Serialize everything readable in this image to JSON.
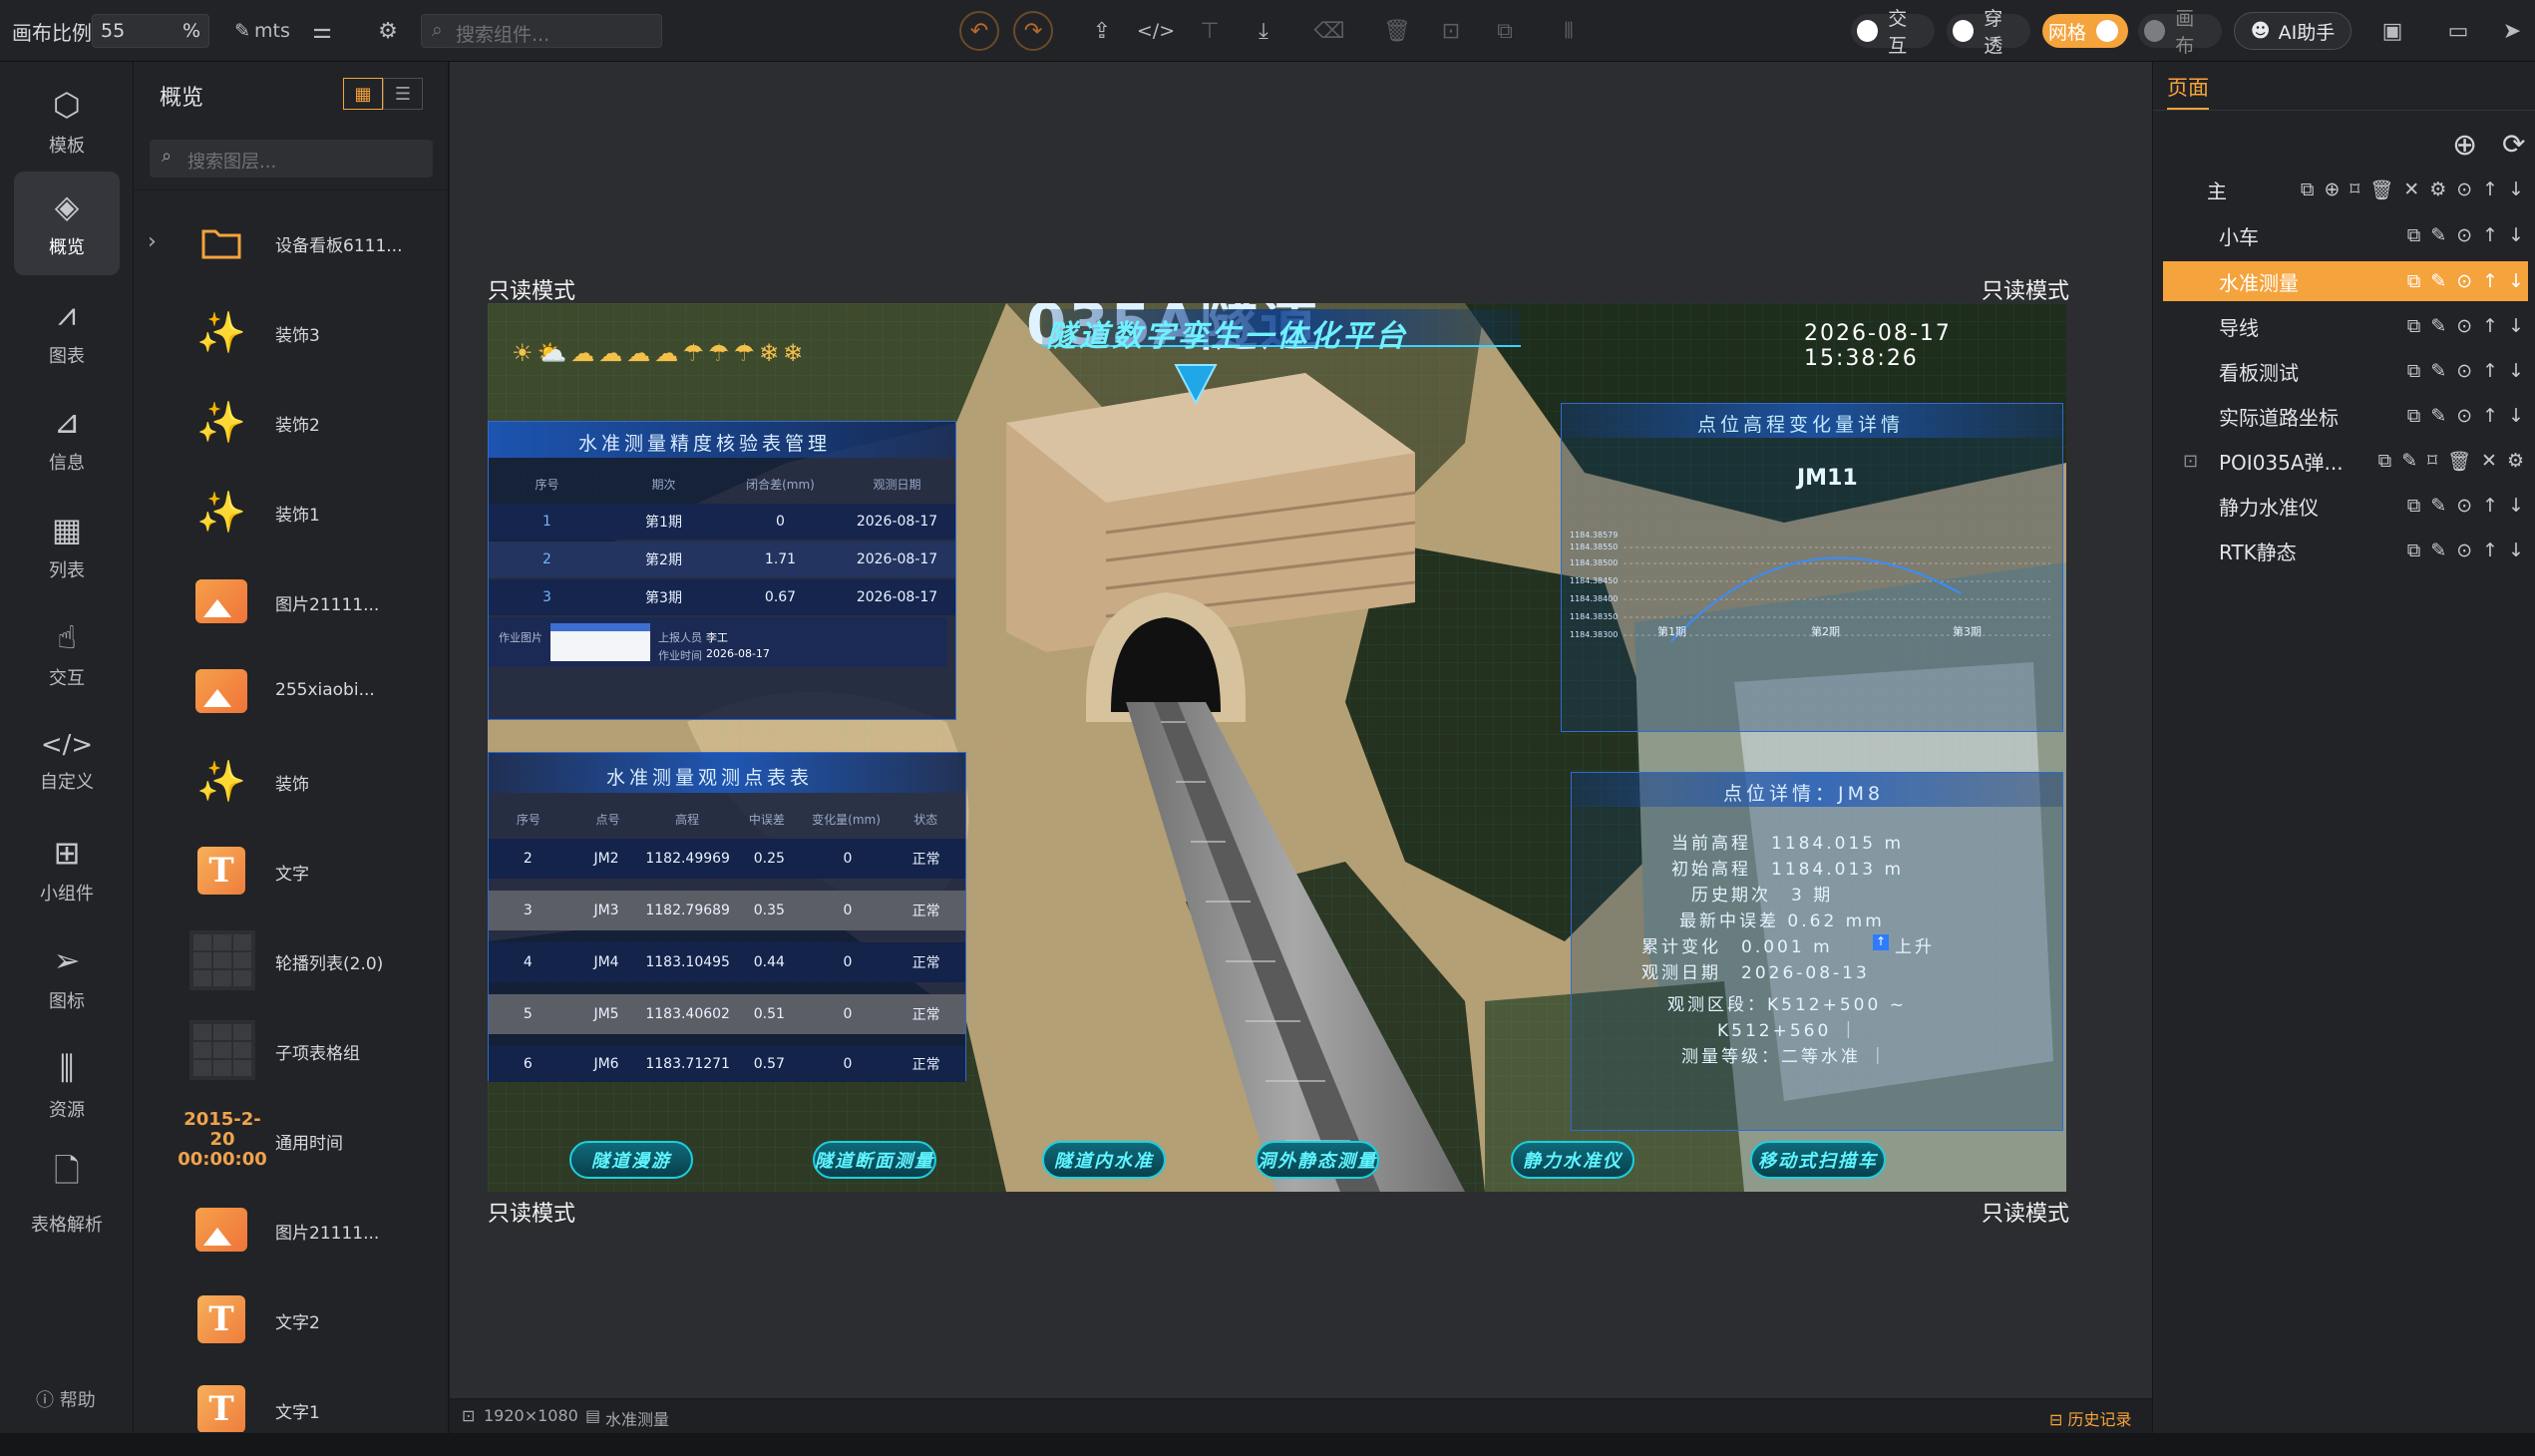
{
  "topbar": {
    "scale_label": "画布比例",
    "scale_value": "55",
    "scale_unit": "%",
    "font_label": "mts",
    "search_placeholder": "搜索组件...",
    "toggles": [
      {
        "label": "交互",
        "on": false
      },
      {
        "label": "穿透",
        "on": false
      },
      {
        "label": "网格",
        "on": true
      },
      {
        "label": "画布",
        "on": false
      }
    ],
    "ai_label": "AI助手"
  },
  "leftnav": {
    "items": [
      {
        "label": "模板",
        "icon": "template-icon"
      },
      {
        "label": "概览",
        "icon": "layers-icon",
        "active": true
      },
      {
        "label": "图表",
        "icon": "chart-icon"
      },
      {
        "label": "信息",
        "icon": "info-icon"
      },
      {
        "label": "列表",
        "icon": "table-icon"
      },
      {
        "label": "交互",
        "icon": "interaction-icon"
      },
      {
        "label": "自定义",
        "icon": "code-icon"
      },
      {
        "label": "小组件",
        "icon": "widget-icon"
      },
      {
        "label": "图标",
        "icon": "send-icon"
      },
      {
        "label": "资源",
        "icon": "resource-icon"
      },
      {
        "label": "表格解析",
        "icon": "file-parse-icon"
      }
    ],
    "help": "帮助"
  },
  "layers": {
    "title": "概览",
    "search_placeholder": "搜索图层...",
    "items": [
      {
        "name": "设备看板6111...",
        "type": "folder"
      },
      {
        "name": "装饰3",
        "type": "deco"
      },
      {
        "name": "装饰2",
        "type": "deco"
      },
      {
        "name": "装饰1",
        "type": "deco"
      },
      {
        "name": "图片21111...",
        "type": "image"
      },
      {
        "name": "255xiaobi...",
        "type": "image"
      },
      {
        "name": "装饰",
        "type": "deco"
      },
      {
        "name": "文字",
        "type": "text"
      },
      {
        "name": "轮播列表(2.0)",
        "type": "table"
      },
      {
        "name": "子项表格组",
        "type": "table"
      },
      {
        "name": "通用时间",
        "type": "time",
        "preview": [
          "2015-2-20",
          "00:00:00"
        ]
      },
      {
        "name": "图片21111...",
        "type": "image"
      },
      {
        "name": "文字2",
        "type": "text"
      },
      {
        "name": "文字1",
        "type": "text"
      }
    ]
  },
  "canvas": {
    "readonly_label": "只读模式",
    "size": "1920×1080",
    "page": "水准测量",
    "history": "历史记录"
  },
  "screen": {
    "title_partial": "035A隧道",
    "subtitle": "隧道数字孪生一体化平台",
    "datetime": "2026-08-17 15:38:26",
    "check_table": {
      "title": "水准测量精度核验表管理",
      "headers": [
        "序号",
        "期次",
        "闭合差(mm)",
        "观测日期"
      ],
      "rows": [
        [
          "1",
          "第1期",
          "0",
          "2026-08-17"
        ],
        [
          "2",
          "第2期",
          "1.71",
          "2026-08-17"
        ],
        [
          "3",
          "第3期",
          "0.67",
          "2026-08-17"
        ]
      ],
      "detail": {
        "photo_label": "作业图片",
        "person_label": "上报人员",
        "person": "李工",
        "time_label": "作业时间",
        "time": "2026-08-17"
      }
    },
    "obs_table": {
      "title": "水准测量观测点表表",
      "headers": [
        "序号",
        "点号",
        "高程",
        "中误差",
        "变化量(mm)",
        "状态"
      ],
      "rows": [
        [
          "2",
          "JM2",
          "1182.49969",
          "0.25",
          "0",
          "正常"
        ],
        [
          "3",
          "JM3",
          "1182.79689",
          "0.35",
          "0",
          "正常"
        ],
        [
          "4",
          "JM4",
          "1183.10495",
          "0.44",
          "0",
          "正常"
        ],
        [
          "5",
          "JM5",
          "1183.40602",
          "0.51",
          "0",
          "正常"
        ],
        [
          "6",
          "JM6",
          "1183.71271",
          "0.57",
          "0",
          "正常"
        ]
      ]
    },
    "trend": {
      "title": "点位高程变化量详情",
      "point": "JM11",
      "y_ticks": [
        "1184.38579",
        "1184.38550",
        "1184.38500",
        "1184.38450",
        "1184.38400",
        "1184.38350",
        "1184.38300"
      ],
      "x_ticks": [
        "第1期",
        "第2期",
        "第3期"
      ]
    },
    "point_detail": {
      "title": "点位详情：JM8",
      "lines": [
        "当前高程　1184.015 m",
        "初始高程　1184.013 m",
        "历史期次　3 期",
        "最新中误差 0.62 mm",
        "累计变化　0.001 m",
        "观测日期　2026-08-13",
        "观测区段：K512+500 ~",
        "K512+560 ｜",
        "测量等级：二等水准 ｜"
      ],
      "trend_label": "上升"
    },
    "buttons": [
      "隧道漫游",
      "隧道断面测量",
      "隧道内水准",
      "洞外静态测量",
      "静力水准仪",
      "移动式扫描车"
    ]
  },
  "pages": {
    "tab": "页面",
    "items": [
      {
        "name": "主",
        "selected": false
      },
      {
        "name": "小车",
        "selected": false
      },
      {
        "name": "水准测量",
        "selected": true
      },
      {
        "name": "导线",
        "selected": false
      },
      {
        "name": "看板测试",
        "selected": false
      },
      {
        "name": "实际道路坐标",
        "selected": false
      },
      {
        "name": "POI035A弹...",
        "selected": false
      },
      {
        "name": "静力水准仪",
        "selected": false
      },
      {
        "name": "RTK静态",
        "selected": false
      }
    ]
  },
  "colors": {
    "accent": "#f5a33c",
    "panel_border": "#2f6bd3",
    "neon": "#5ff4ff"
  }
}
